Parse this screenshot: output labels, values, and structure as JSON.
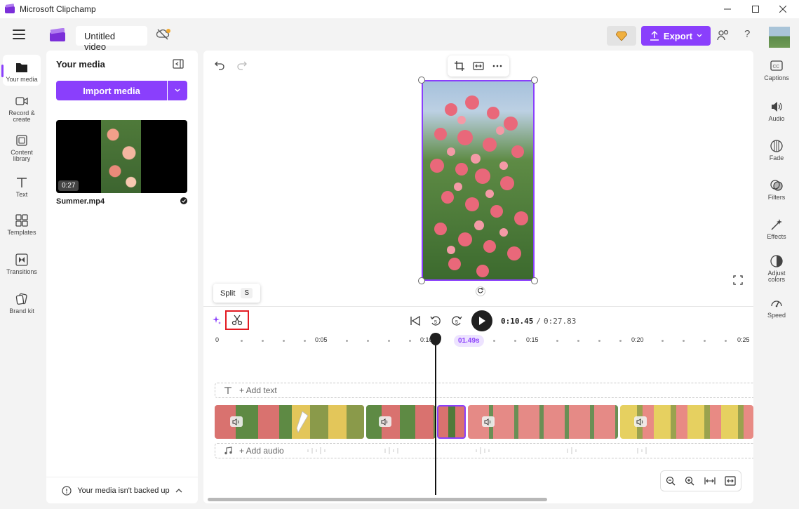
{
  "window": {
    "title": "Microsoft Clipchamp"
  },
  "topbar": {
    "project_title": "Untitled video",
    "export_label": "Export"
  },
  "left_rail": {
    "items": [
      {
        "label": "Your media"
      },
      {
        "label": "Record &",
        "label2": "create"
      },
      {
        "label": "Content",
        "label2": "library"
      },
      {
        "label": "Text"
      },
      {
        "label": "Templates"
      },
      {
        "label": "Transitions"
      },
      {
        "label": "Brand kit"
      }
    ]
  },
  "media_panel": {
    "title": "Your media",
    "import_label": "Import media",
    "items": [
      {
        "name": "Summer.mp4",
        "duration": "0:27"
      }
    ],
    "backup_note": "Your media isn't backed up"
  },
  "tooltip": {
    "label": "Split",
    "shortcut": "S"
  },
  "transport": {
    "current_time": "0:10.45",
    "separator": "/",
    "total_time": "0:27.83"
  },
  "timeline": {
    "ruler_labels": [
      "0",
      "0:05",
      "0:10",
      "0:15",
      "0:20",
      "0:25"
    ],
    "playhead_badge": "01.49s",
    "add_text_label": "+ Add text",
    "add_audio_label": "+ Add audio"
  },
  "right_rail": {
    "items": [
      {
        "label": "Captions"
      },
      {
        "label": "Audio"
      },
      {
        "label": "Fade"
      },
      {
        "label": "Filters"
      },
      {
        "label": "Effects"
      },
      {
        "label": "Adjust",
        "label2": "colors"
      },
      {
        "label": "Speed"
      }
    ]
  },
  "colors": {
    "accent": "#8a3ffc",
    "highlight_border": "#e31b23"
  }
}
